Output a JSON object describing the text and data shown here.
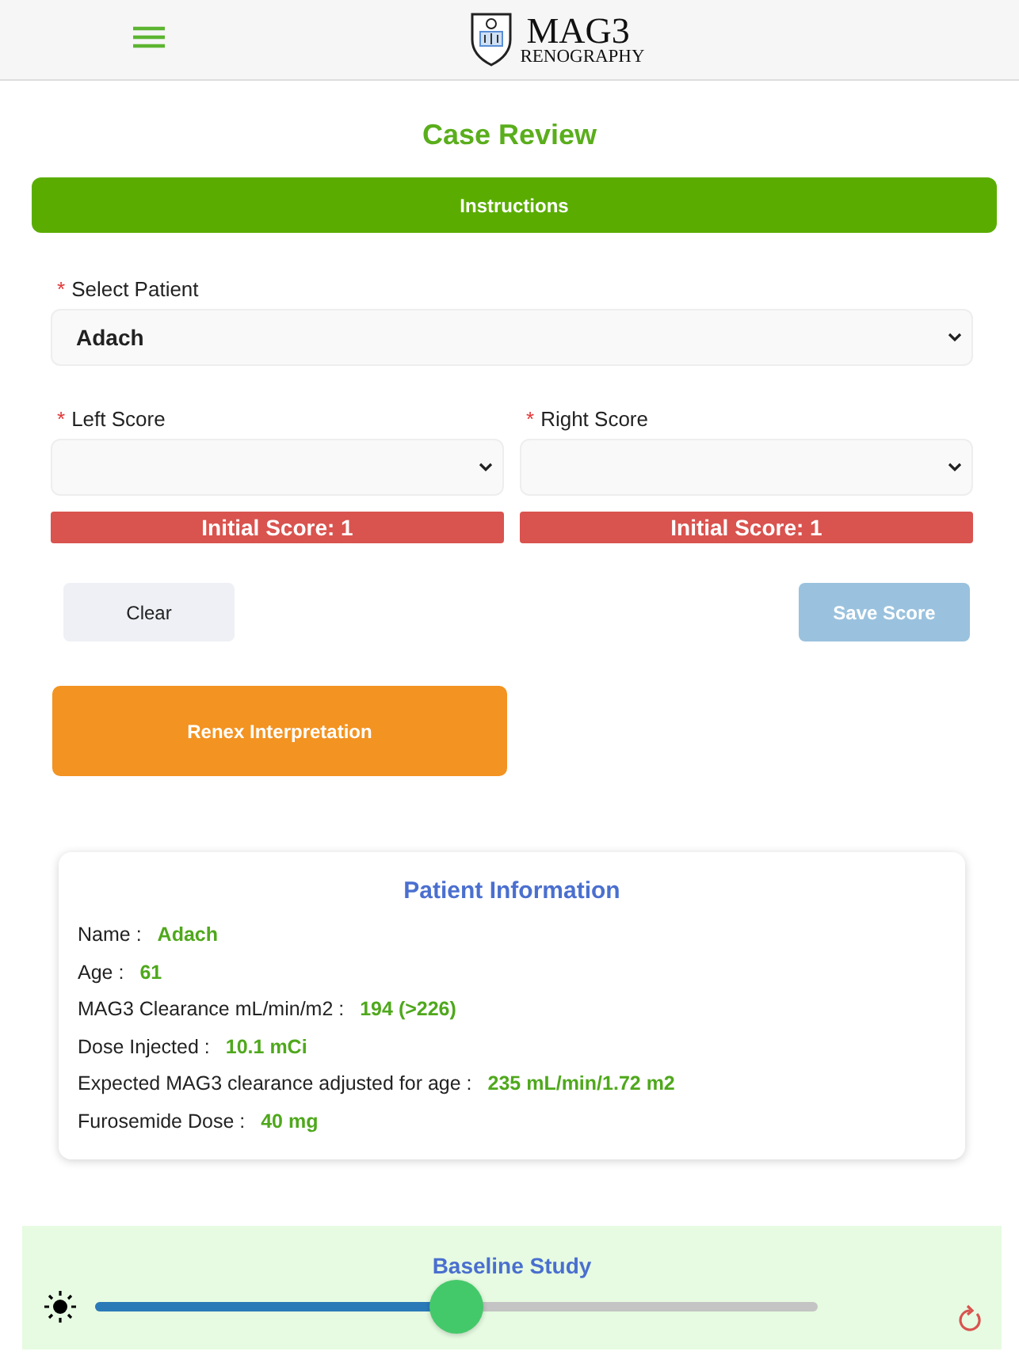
{
  "header": {
    "logo": {
      "title": "MAG3",
      "subtitle": "RENOGRAPHY"
    }
  },
  "page_title": "Case Review",
  "instructions_button": "Instructions",
  "patient_select": {
    "label": "Select Patient",
    "required_mark": "*",
    "value": "Adach"
  },
  "score_selects": [
    {
      "label": "Left Score",
      "required_mark": "*",
      "initial_score": "Initial Score: 1"
    },
    {
      "label": "Right Score",
      "required_mark": "*",
      "initial_score": "Initial Score: 1"
    }
  ],
  "buttons": [
    {
      "label": "Clear",
      "kind": "secondary",
      "disabled": false
    },
    {
      "label": "Save Score",
      "kind": "primary",
      "disabled": true
    }
  ],
  "interpretation_button": "Renex Interpretation",
  "patient_info": {
    "title": "Patient Information",
    "rows": [
      {
        "label": "Name :",
        "value": "Adach"
      },
      {
        "label": "Age :",
        "value": "61"
      },
      {
        "label": "MAG3 Clearance mL/min/m2 :",
        "value": "194 (>226)"
      },
      {
        "label": "Dose Injected :",
        "value": "10.1 mCi"
      },
      {
        "label": "Expected MAG3 clearance adjusted for age :",
        "value": "235 mL/min/1.72 m2"
      },
      {
        "label": "Furosemide Dose :",
        "value": "40 mg"
      }
    ]
  },
  "study": {
    "title": "Baseline Study",
    "brightness": {
      "level": 0.5
    }
  }
}
